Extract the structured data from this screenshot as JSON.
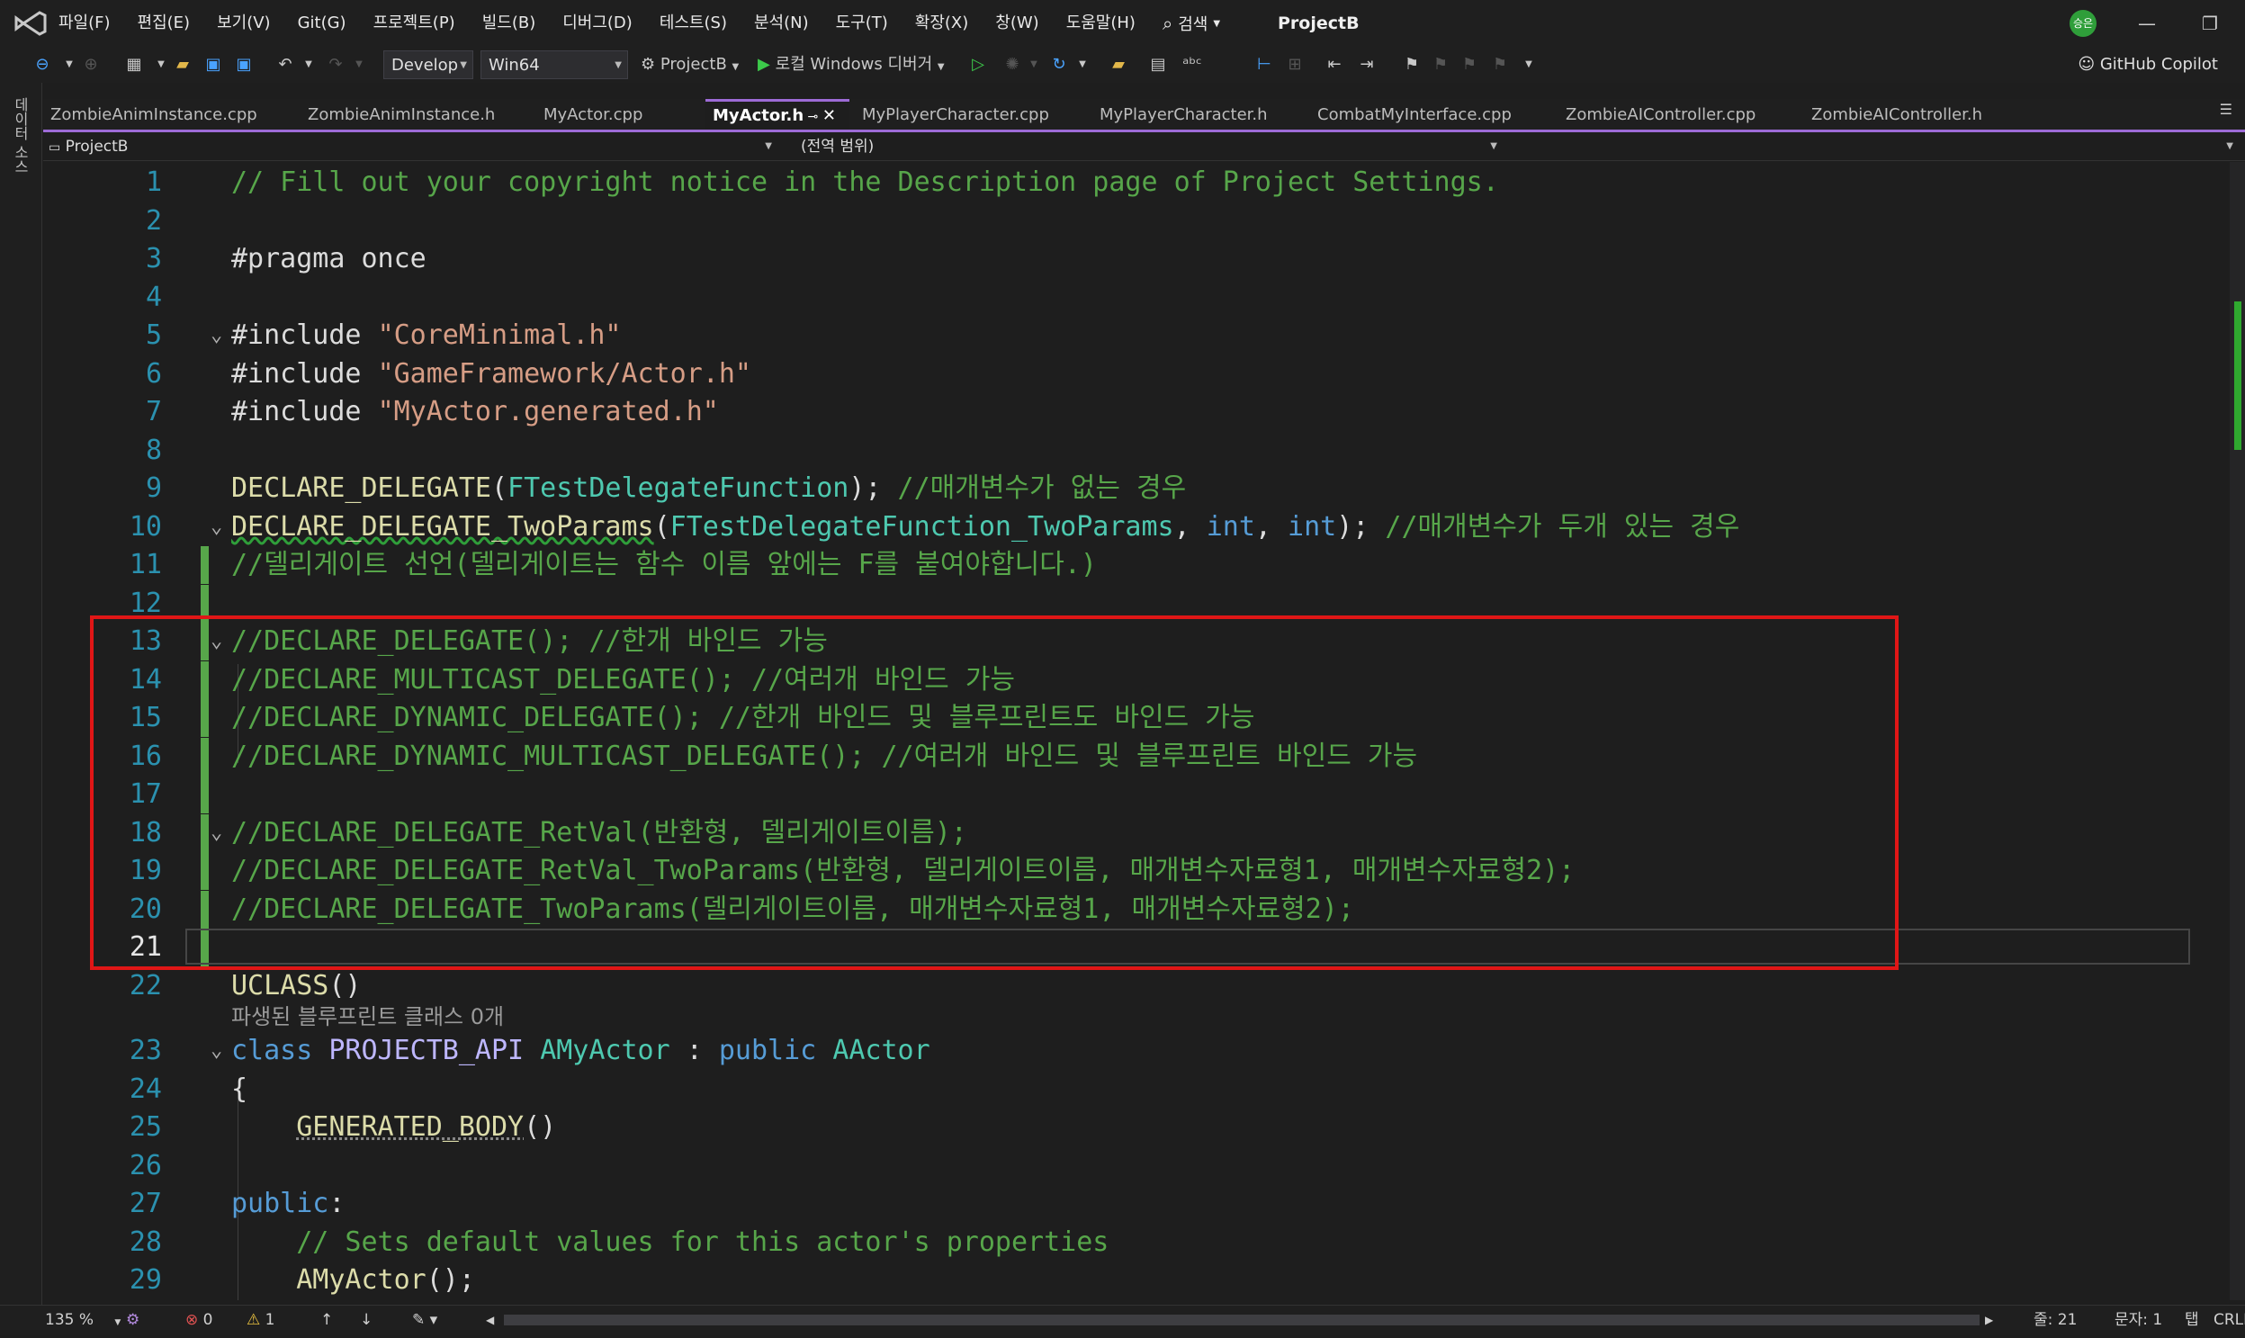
{
  "menubar": {
    "items": [
      "파일(F)",
      "편집(E)",
      "보기(V)",
      "Git(G)",
      "프로젝트(P)",
      "빌드(B)",
      "디버그(D)",
      "테스트(S)",
      "분석(N)",
      "도구(T)",
      "확장(X)",
      "창(W)",
      "도움말(H)"
    ],
    "search_label": "검색",
    "solution_name": "ProjectB",
    "user_initials": "승은"
  },
  "toolbar": {
    "configuration": "Develop",
    "platform": "Win64",
    "startup_project": "ProjectB",
    "debug_target": "로컬 Windows 디버거",
    "copilot_label": "GitHub Copilot"
  },
  "left_rail": {
    "label": "데이터 소스"
  },
  "tabs": [
    {
      "label": "ZombieAnimInstance.cpp",
      "active": false
    },
    {
      "label": "ZombieAnimInstance.h",
      "active": false
    },
    {
      "label": "MyActor.cpp",
      "active": false
    },
    {
      "label": "MyActor.h",
      "active": true
    },
    {
      "label": "MyPlayerCharacter.cpp",
      "active": false
    },
    {
      "label": "MyPlayerCharacter.h",
      "active": false
    },
    {
      "label": "CombatMyInterface.cpp",
      "active": false
    },
    {
      "label": "ZombieAIController.cpp",
      "active": false
    },
    {
      "label": "ZombieAIController.h",
      "active": false
    }
  ],
  "navbar": {
    "project_scope": "ProjectB",
    "member_scope": "(전역 범위)"
  },
  "editor": {
    "current_line": 21,
    "lines": [
      {
        "n": "1",
        "tokens": [
          {
            "t": "// Fill out your copyright notice in the Description page of Project Settings.",
            "c": "cmt"
          }
        ]
      },
      {
        "n": "2",
        "tokens": []
      },
      {
        "n": "3",
        "tokens": [
          {
            "t": "#pragma once",
            "c": "plain"
          }
        ]
      },
      {
        "n": "4",
        "tokens": []
      },
      {
        "n": "5",
        "fold": true,
        "tokens": [
          {
            "t": "#include ",
            "c": "plain"
          },
          {
            "t": "\"CoreMinimal.h\"",
            "c": "str"
          }
        ]
      },
      {
        "n": "6",
        "tokens": [
          {
            "t": "#include ",
            "c": "plain"
          },
          {
            "t": "\"GameFramework/Actor.h\"",
            "c": "str"
          }
        ]
      },
      {
        "n": "7",
        "tokens": [
          {
            "t": "#include ",
            "c": "plain"
          },
          {
            "t": "\"MyActor.generated.h\"",
            "c": "str"
          }
        ]
      },
      {
        "n": "8",
        "tokens": []
      },
      {
        "n": "9",
        "tokens": [
          {
            "t": "DECLARE_DELEGATE",
            "c": "mac2"
          },
          {
            "t": "(",
            "c": "plain"
          },
          {
            "t": "FTestDelegateFunction",
            "c": "type"
          },
          {
            "t": "); ",
            "c": "plain"
          },
          {
            "t": "//매개변수가 없는 경우",
            "c": "cmt"
          }
        ]
      },
      {
        "n": "10",
        "fold": true,
        "tokens": [
          {
            "t": "DECLARE_DELEGATE_TwoParams",
            "c": "mac2 squiggle"
          },
          {
            "t": "(",
            "c": "plain"
          },
          {
            "t": "FTestDelegateFunction_TwoParams",
            "c": "type"
          },
          {
            "t": ", ",
            "c": "plain"
          },
          {
            "t": "int",
            "c": "kw"
          },
          {
            "t": ", ",
            "c": "plain"
          },
          {
            "t": "int",
            "c": "kw"
          },
          {
            "t": "); ",
            "c": "plain"
          },
          {
            "t": "//매개변수가 두개 있는 경우",
            "c": "cmt"
          }
        ]
      },
      {
        "n": "11",
        "changed": true,
        "tokens": [
          {
            "t": "//델리게이트 선언(델리게이트는 함수 이름 앞에는 F를 붙여야합니다.)",
            "c": "cmt"
          }
        ]
      },
      {
        "n": "12",
        "changed": true,
        "tokens": []
      },
      {
        "n": "13",
        "changed": true,
        "fold": true,
        "tokens": [
          {
            "t": "//DECLARE_DELEGATE(); //한개 바인드 가능",
            "c": "cmt"
          }
        ]
      },
      {
        "n": "14",
        "changed": true,
        "tokens": [
          {
            "t": "//DECLARE_MULTICAST_DELEGATE(); //여러개 바인드 가능",
            "c": "cmt"
          }
        ]
      },
      {
        "n": "15",
        "changed": true,
        "tokens": [
          {
            "t": "//DECLARE_DYNAMIC_DELEGATE(); //한개 바인드 및 블루프린트도 바인드 가능",
            "c": "cmt"
          }
        ]
      },
      {
        "n": "16",
        "changed": true,
        "tokens": [
          {
            "t": "//DECLARE_DYNAMIC_MULTICAST_DELEGATE(); //여러개 바인드 및 블루프린트 바인드 가능",
            "c": "cmt"
          }
        ]
      },
      {
        "n": "17",
        "changed": true,
        "tokens": []
      },
      {
        "n": "18",
        "changed": true,
        "fold": true,
        "tokens": [
          {
            "t": "//DECLARE_DELEGATE_RetVal(반환형, 델리게이트이름);",
            "c": "cmt"
          }
        ]
      },
      {
        "n": "19",
        "changed": true,
        "tokens": [
          {
            "t": "//DECLARE_DELEGATE_RetVal_TwoParams(반환형, 델리게이트이름, 매개변수자료형1, 매개변수자료형2);",
            "c": "cmt"
          }
        ]
      },
      {
        "n": "20",
        "changed": true,
        "tokens": [
          {
            "t": "//DECLARE_DELEGATE_TwoParams(델리게이트이름, 매개변수자료형1, 매개변수자료형2);",
            "c": "cmt"
          }
        ]
      },
      {
        "n": "21",
        "changed": true,
        "current": true,
        "tokens": []
      },
      {
        "n": "22",
        "tokens": [
          {
            "t": "UCLASS",
            "c": "mac2"
          },
          {
            "t": "()",
            "c": "plain"
          }
        ]
      },
      {
        "n": "23",
        "fold": true,
        "tokens": [
          {
            "t": "class ",
            "c": "kw"
          },
          {
            "t": "PROJECTB_API ",
            "c": "macro"
          },
          {
            "t": "AMyActor",
            "c": "type"
          },
          {
            "t": " : ",
            "c": "plain"
          },
          {
            "t": "public ",
            "c": "kw"
          },
          {
            "t": "AActor",
            "c": "type"
          }
        ]
      },
      {
        "n": "24",
        "tokens": [
          {
            "t": "{",
            "c": "plain"
          }
        ]
      },
      {
        "n": "25",
        "tokens": [
          {
            "t": "    ",
            "c": "plain"
          },
          {
            "t": "GENERATED_BODY",
            "c": "mac2 dotted"
          },
          {
            "t": "()",
            "c": "plain"
          }
        ]
      },
      {
        "n": "26",
        "tokens": []
      },
      {
        "n": "27",
        "tokens": [
          {
            "t": "public",
            "c": "kw"
          },
          {
            "t": ":",
            "c": "plain"
          }
        ]
      },
      {
        "n": "28",
        "tokens": [
          {
            "t": "    // Sets default values for this actor's properties",
            "c": "cmt"
          }
        ]
      },
      {
        "n": "29",
        "tokens": [
          {
            "t": "    ",
            "c": "plain"
          },
          {
            "t": "AMyActor",
            "c": "mac2"
          },
          {
            "t": "();",
            "c": "plain"
          }
        ]
      }
    ],
    "codelens_text": "파생된 블루프린트 클래스 0개"
  },
  "statusbar": {
    "zoom": "135 %",
    "errors": "0",
    "warnings": "1",
    "line_label": "줄: 21",
    "char_label": "문자: 1",
    "indent_label": "탭",
    "eol_label": "CRLF"
  },
  "colors": {
    "highlight_box": "#e01616",
    "change_bar": "#57a64a",
    "active_tab_accent": "#9d6bd6"
  }
}
